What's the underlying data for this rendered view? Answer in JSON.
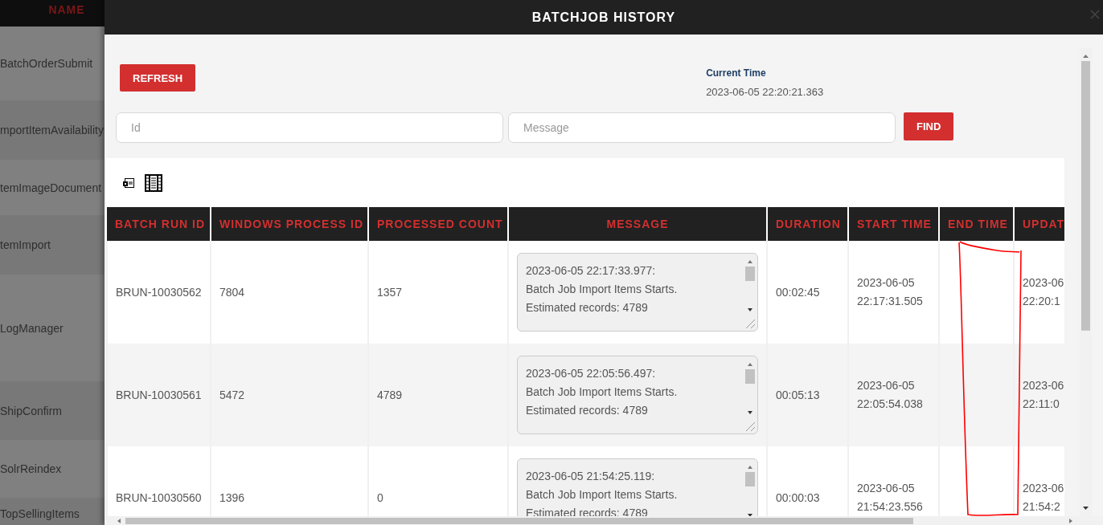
{
  "background_list": {
    "header": "NAME",
    "items": [
      {
        "name": "BatchOrderSubmit"
      },
      {
        "name": "mportItemAvailability"
      },
      {
        "name": "temImageDocument"
      },
      {
        "name": "temImport"
      },
      {
        "name": "LogManager"
      },
      {
        "name": "ShipConfirm"
      },
      {
        "name": "SolrReindex"
      },
      {
        "name": "TopSellingItems"
      }
    ]
  },
  "dialog": {
    "title": "BATCHJOB HISTORY",
    "refresh_button": "REFRESH",
    "current_time": {
      "label": "Current Time",
      "value": "2023-06-05 22:20:21.363"
    },
    "filters": [
      {
        "placeholder": "Id"
      },
      {
        "placeholder": "Message"
      }
    ],
    "find_button": "FIND",
    "table": {
      "columns": [
        "BATCH RUN ID",
        "WINDOWS PROCESS ID",
        "PROCESSED COUNT",
        "MESSAGE",
        "DURATION",
        "START TIME",
        "END TIME",
        "UPDAT"
      ],
      "rows": [
        {
          "batch_run_id": "BRUN-10030562",
          "windows_process_id": "7804",
          "processed_count": "1357",
          "message": [
            "2023-06-05 22:17:33.977:",
            " Batch Job Import Items Starts.",
            "Estimated records: 4789"
          ],
          "duration": "00:02:45",
          "start_time": [
            "2023-06-05",
            "22:17:31.505"
          ],
          "update": [
            "2023-06",
            "22:20:1"
          ]
        },
        {
          "batch_run_id": "BRUN-10030561",
          "windows_process_id": "5472",
          "processed_count": "4789",
          "message": [
            "2023-06-05 22:05:56.497:",
            " Batch Job Import Items Starts.",
            "Estimated records: 4789"
          ],
          "duration": "00:05:13",
          "start_time": [
            "2023-06-05",
            "22:05:54.038"
          ],
          "update": [
            "2023-06",
            "22:11:0"
          ]
        },
        {
          "batch_run_id": "BRUN-10030560",
          "windows_process_id": "1396",
          "processed_count": "0",
          "message": [
            "2023-06-05 21:54:25.119:",
            " Batch Job Import Items Starts.",
            "Estimated records: 4789"
          ],
          "duration": "00:00:03",
          "start_time": [
            "2023-06-05",
            "21:54:23.556"
          ],
          "update": [
            "2023-06",
            "21:54:2"
          ]
        }
      ]
    }
  }
}
